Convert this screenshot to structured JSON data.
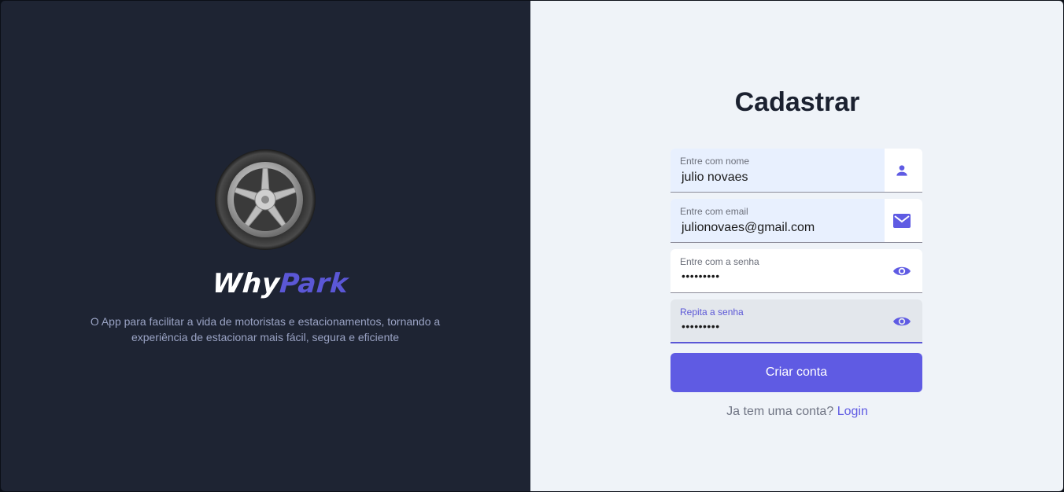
{
  "brand": {
    "name_part1": "Why",
    "name_part2": "Park",
    "tagline": "O App para facilitar a vida de motoristas e estacionamentos, tornando a experiência de estacionar mais fácil, segura e eficiente"
  },
  "form": {
    "title": "Cadastrar",
    "fields": [
      {
        "label": "Entre com nome",
        "value": "julio novaes",
        "icon": "person-icon"
      },
      {
        "label": "Entre com email",
        "value": "julionovaes@gmail.com",
        "icon": "mail-icon"
      },
      {
        "label": "Entre com a senha",
        "value": "•••••••••",
        "icon": "eye-icon"
      },
      {
        "label": "Repita a senha",
        "value": "•••••••••",
        "icon": "eye-icon"
      }
    ],
    "submit_label": "Criar conta",
    "footer_text": "Ja tem uma conta?",
    "login_link": "Login"
  },
  "colors": {
    "left_bg": "#1e2433",
    "right_bg": "#eff3f8",
    "accent": "#5f5be3"
  }
}
